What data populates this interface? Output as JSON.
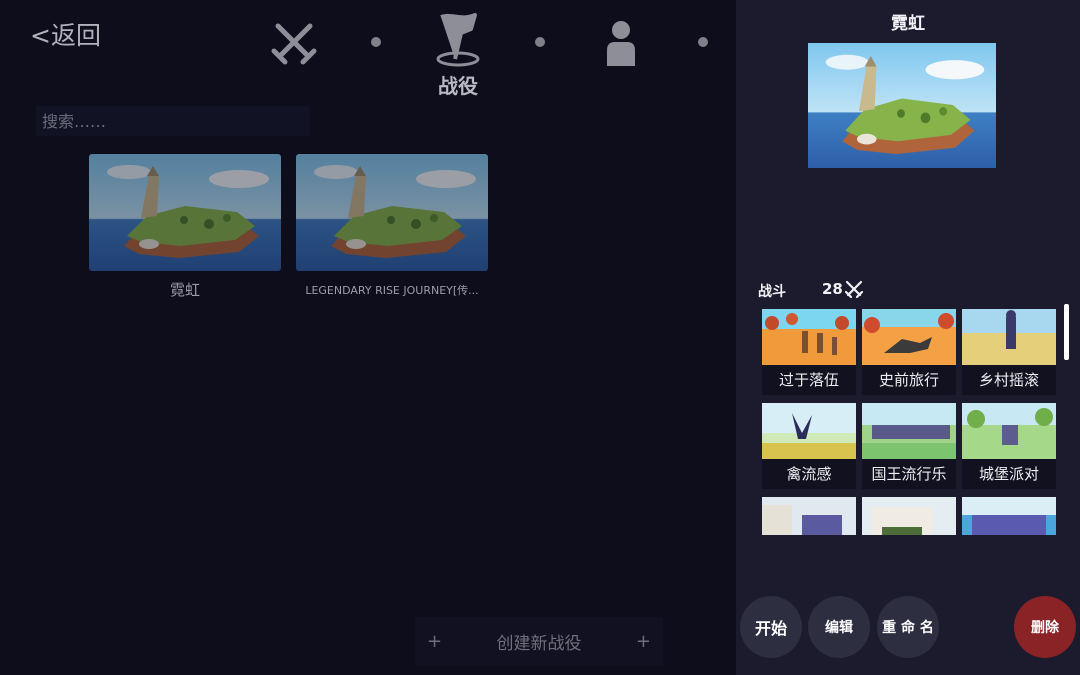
{
  "nav": {
    "back_label": "<返回",
    "modes": [
      {
        "icon": "crossed-swords-icon"
      },
      {
        "icon": "flag-icon"
      },
      {
        "icon": "person-icon"
      }
    ],
    "active_mode_label": "战役"
  },
  "search": {
    "placeholder": "搜索……"
  },
  "campaigns": [
    {
      "name": "霓虹"
    },
    {
      "name": "LEGENDARY RISE JOURNEY[传..."
    }
  ],
  "create": {
    "label": "创建新战役",
    "plus_left": "+",
    "plus_right": "+"
  },
  "detail": {
    "title": "霓虹",
    "battles_label": "战斗",
    "battle_count": "28",
    "battles": [
      {
        "name": "过于落伍"
      },
      {
        "name": "史前旅行"
      },
      {
        "name": "乡村摇滚"
      },
      {
        "name": "禽流感"
      },
      {
        "name": "国王流行乐"
      },
      {
        "name": "城堡派对"
      },
      {
        "name": ""
      },
      {
        "name": ""
      },
      {
        "name": ""
      }
    ]
  },
  "actions": {
    "start": "开始",
    "edit": "编辑",
    "rename": "重 命 名",
    "delete": "删除"
  },
  "colors": {
    "background": "#0d0d1c",
    "panel": "#1b1b2d",
    "button": "#2e2e41",
    "delete_button": "#8a2326",
    "icon": "#8d8e97"
  }
}
